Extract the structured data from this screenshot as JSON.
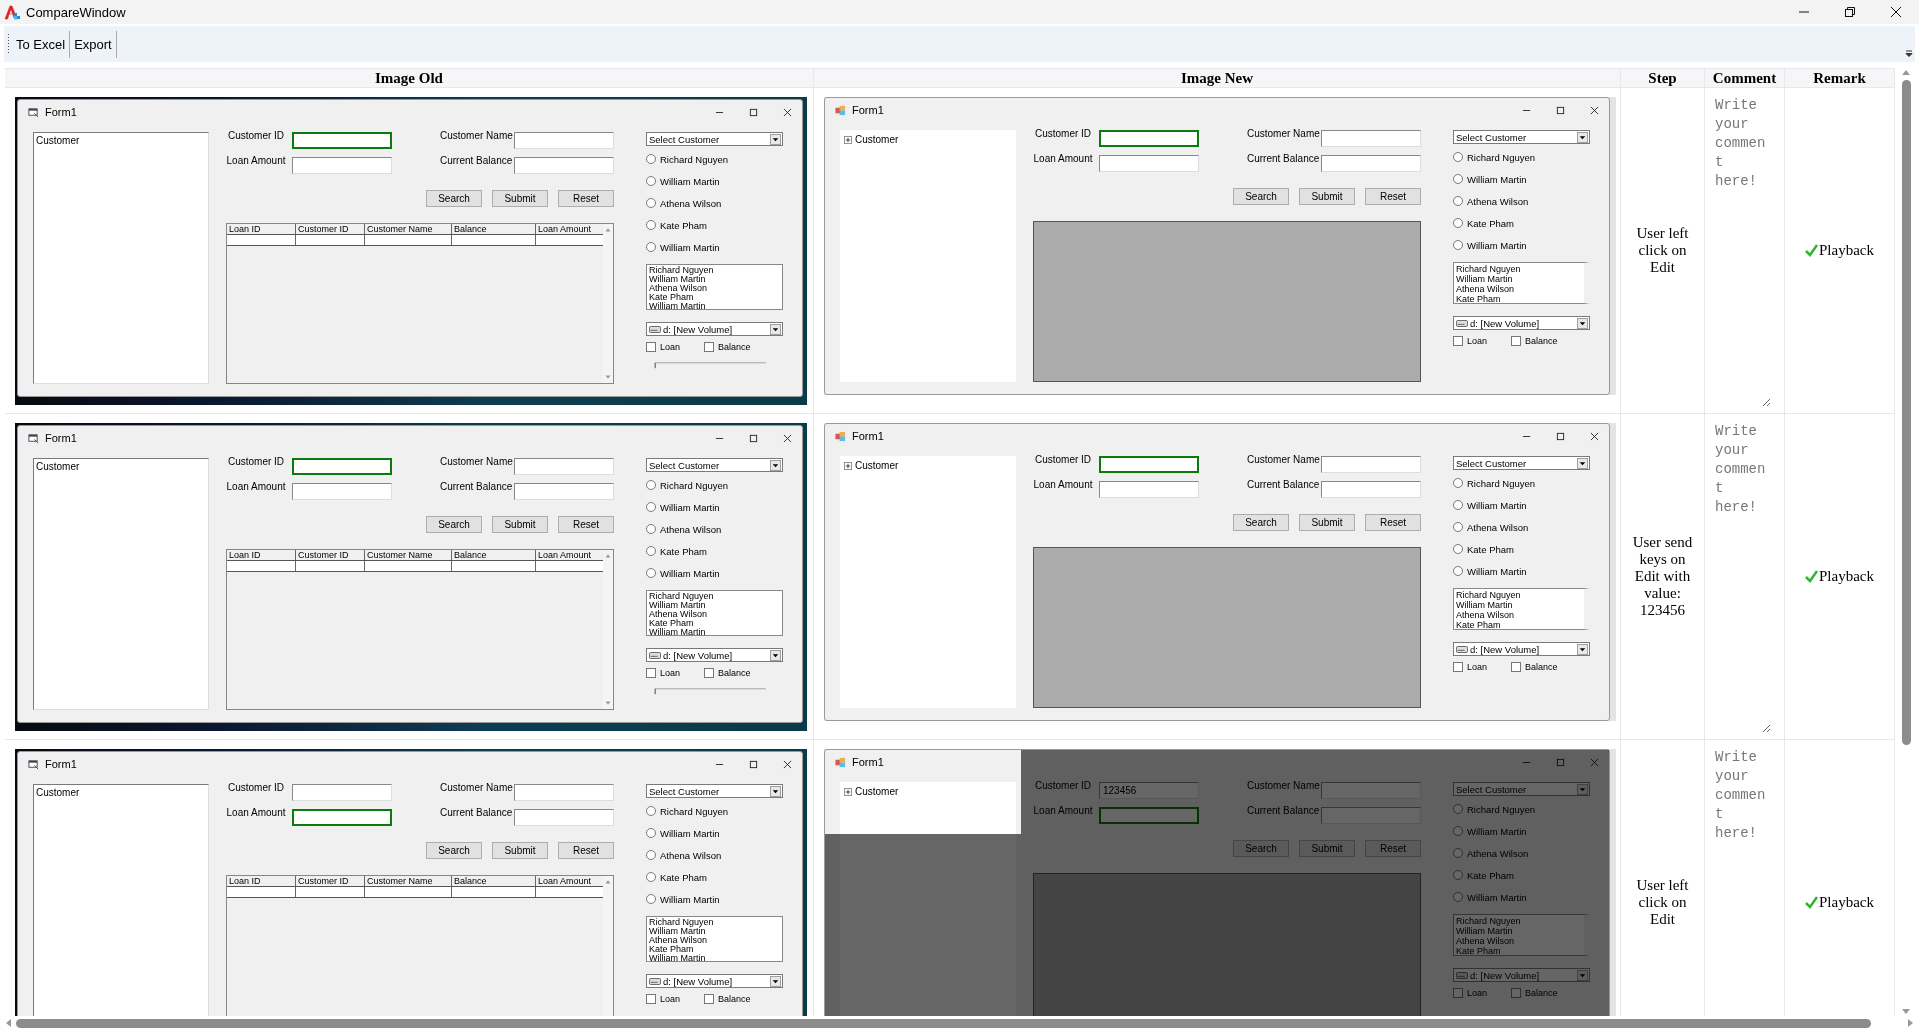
{
  "window": {
    "title": "CompareWindow"
  },
  "toolbar": [
    {
      "label": "To Excel"
    },
    {
      "label": "Export"
    }
  ],
  "table": {
    "columns": [
      "Image Old",
      "Image New",
      "Step",
      "Comment",
      "Remark"
    ],
    "rows": [
      {
        "image_old": {
          "kind": "old",
          "title": "Form1",
          "tree": {
            "label": "Customer"
          },
          "fields": [
            {
              "label": "Customer ID",
              "focused": true
            },
            {
              "label": "Customer Name",
              "focused": false
            },
            {
              "label": "Loan Amount",
              "focused": false
            },
            {
              "label": "Current Balance",
              "focused": false
            }
          ],
          "buttons": [
            "Search",
            "Submit",
            "Reset"
          ],
          "grid": {
            "kind": "table",
            "columns": [
              "Loan ID",
              "Customer ID",
              "Customer Name",
              "Balance",
              "Loan Amount"
            ]
          },
          "combo": "Select Customer",
          "radios": [
            {
              "label": "Richard Nguyen",
              "selected": false
            },
            {
              "label": "William Martin",
              "selected": false
            },
            {
              "label": "Athena Wilson",
              "selected": false
            },
            {
              "label": "Kate Pham",
              "selected": false
            },
            {
              "label": "William Martin",
              "selected": false
            }
          ],
          "list": [
            "Richard Nguyen",
            "William Martin",
            "Athena Wilson",
            "Kate Pham",
            "William Martin"
          ],
          "drive": "d: [New Volume]",
          "checkboxes": [
            {
              "label": "Loan",
              "checked": false
            },
            {
              "label": "Balance",
              "checked": false
            }
          ],
          "trackbar": true
        },
        "image_new": {
          "kind": "new",
          "title": "Form1",
          "tree": {
            "label": "Customer",
            "expandable": true
          },
          "fields": [
            {
              "label": "Customer ID",
              "focused": true
            },
            {
              "label": "Customer Name",
              "focused": false
            },
            {
              "label": "Loan Amount",
              "focused": false
            },
            {
              "label": "Current Balance",
              "focused": false
            }
          ],
          "buttons": [
            "Search",
            "Submit",
            "Reset"
          ],
          "grid": {
            "kind": "empty"
          },
          "combo": "Select Customer",
          "radios": [
            {
              "label": "Richard Nguyen",
              "selected": false
            },
            {
              "label": "William Martin",
              "selected": false
            },
            {
              "label": "Athena Wilson",
              "selected": false
            },
            {
              "label": "Kate Pham",
              "selected": false
            },
            {
              "label": "William Martin",
              "selected": false
            }
          ],
          "list": [
            "Richard Nguyen",
            "William Martin",
            "Athena Wilson",
            "Kate Pham"
          ],
          "drive": "d: [New Volume]",
          "checkboxes": [
            {
              "label": "Loan",
              "checked": false
            },
            {
              "label": "Balance",
              "checked": false
            }
          ]
        },
        "step": "User left click on Edit",
        "comment": {
          "placeholder": "Write your comment here!"
        },
        "remark": "Playback"
      },
      {
        "image_old": {
          "kind": "old",
          "title": "Form1",
          "tree": {
            "label": "Customer"
          },
          "fields": [
            {
              "label": "Customer ID",
              "focused": true
            },
            {
              "label": "Customer Name",
              "focused": false
            },
            {
              "label": "Loan Amount",
              "focused": false
            },
            {
              "label": "Current Balance",
              "focused": false
            }
          ],
          "buttons": [
            "Search",
            "Submit",
            "Reset"
          ],
          "grid": {
            "kind": "table",
            "columns": [
              "Loan ID",
              "Customer ID",
              "Customer Name",
              "Balance",
              "Loan Amount"
            ]
          },
          "combo": "Select Customer",
          "radios": [
            {
              "label": "Richard Nguyen",
              "selected": false
            },
            {
              "label": "William Martin",
              "selected": false
            },
            {
              "label": "Athena Wilson",
              "selected": false
            },
            {
              "label": "Kate Pham",
              "selected": false
            },
            {
              "label": "William Martin",
              "selected": false
            }
          ],
          "list": [
            "Richard Nguyen",
            "William Martin",
            "Athena Wilson",
            "Kate Pham",
            "William Martin"
          ],
          "drive": "d: [New Volume]",
          "checkboxes": [
            {
              "label": "Loan",
              "checked": false
            },
            {
              "label": "Balance",
              "checked": false
            }
          ],
          "trackbar": true
        },
        "image_new": {
          "kind": "new",
          "title": "Form1",
          "tree": {
            "label": "Customer",
            "expandable": true
          },
          "fields": [
            {
              "label": "Customer ID",
              "focused": true
            },
            {
              "label": "Customer Name",
              "focused": false
            },
            {
              "label": "Loan Amount",
              "focused": false
            },
            {
              "label": "Current Balance",
              "focused": false
            }
          ],
          "buttons": [
            "Search",
            "Submit",
            "Reset"
          ],
          "grid": {
            "kind": "empty"
          },
          "combo": "Select Customer",
          "radios": [
            {
              "label": "Richard Nguyen",
              "selected": false
            },
            {
              "label": "William Martin",
              "selected": false
            },
            {
              "label": "Athena Wilson",
              "selected": false
            },
            {
              "label": "Kate Pham",
              "selected": false
            },
            {
              "label": "William Martin",
              "selected": false
            }
          ],
          "list": [
            "Richard Nguyen",
            "William Martin",
            "Athena Wilson",
            "Kate Pham"
          ],
          "drive": "d: [New Volume]",
          "checkboxes": [
            {
              "label": "Loan",
              "checked": false
            },
            {
              "label": "Balance",
              "checked": false
            }
          ]
        },
        "step": "User send keys on Edit with value: 123456",
        "comment": {
          "placeholder": "Write your comment here!"
        },
        "remark": "Playback"
      },
      {
        "image_old": {
          "kind": "old",
          "title": "Form1",
          "tree": {
            "label": "Customer"
          },
          "fields": [
            {
              "label": "Customer ID",
              "focused": false
            },
            {
              "label": "Customer Name",
              "focused": false
            },
            {
              "label": "Loan Amount",
              "focused": true
            },
            {
              "label": "Current Balance",
              "focused": false
            }
          ],
          "buttons": [
            "Search",
            "Submit",
            "Reset"
          ],
          "grid": {
            "kind": "table",
            "columns": [
              "Loan ID",
              "Customer ID",
              "Customer Name",
              "Balance",
              "Loan Amount"
            ]
          },
          "combo": "Select Customer",
          "radios": [
            {
              "label": "Richard Nguyen",
              "selected": false
            },
            {
              "label": "William Martin",
              "selected": false
            },
            {
              "label": "Athena Wilson",
              "selected": false
            },
            {
              "label": "Kate Pham",
              "selected": false
            },
            {
              "label": "William Martin",
              "selected": false
            }
          ],
          "list": [
            "Richard Nguyen",
            "William Martin",
            "Athena Wilson",
            "Kate Pham",
            "William Martin"
          ],
          "drive": "d: [New Volume]",
          "checkboxes": [
            {
              "label": "Loan",
              "checked": false
            },
            {
              "label": "Balance",
              "checked": false
            }
          ]
        },
        "image_new": {
          "kind": "new",
          "title": "Form1",
          "tree": {
            "label": "Customer",
            "expandable": true
          },
          "fields": [
            {
              "label": "Customer ID",
              "value": "123456",
              "focused": false
            },
            {
              "label": "Customer Name",
              "focused": false
            },
            {
              "label": "Loan Amount",
              "focused": true
            },
            {
              "label": "Current Balance",
              "focused": false
            }
          ],
          "buttons": [
            "Search",
            "Submit",
            "Reset"
          ],
          "grid": {
            "kind": "empty"
          },
          "combo": "Select Customer",
          "radios": [
            {
              "label": "Richard Nguyen",
              "selected": false
            },
            {
              "label": "William Martin",
              "selected": false
            },
            {
              "label": "Athena Wilson",
              "selected": false
            },
            {
              "label": "Kate Pham",
              "selected": false
            },
            {
              "label": "William Martin",
              "selected": false
            }
          ],
          "list": [
            "Richard Nguyen",
            "William Martin",
            "Athena Wilson",
            "Kate Pham"
          ],
          "drive": "d: [New Volume]",
          "checkboxes": [
            {
              "label": "Loan",
              "checked": false
            },
            {
              "label": "Balance",
              "checked": false
            }
          ],
          "dimmed": true
        },
        "step": "User left click on Edit",
        "comment": {
          "placeholder": "Write your comment here!"
        },
        "remark": "Playback"
      }
    ]
  }
}
